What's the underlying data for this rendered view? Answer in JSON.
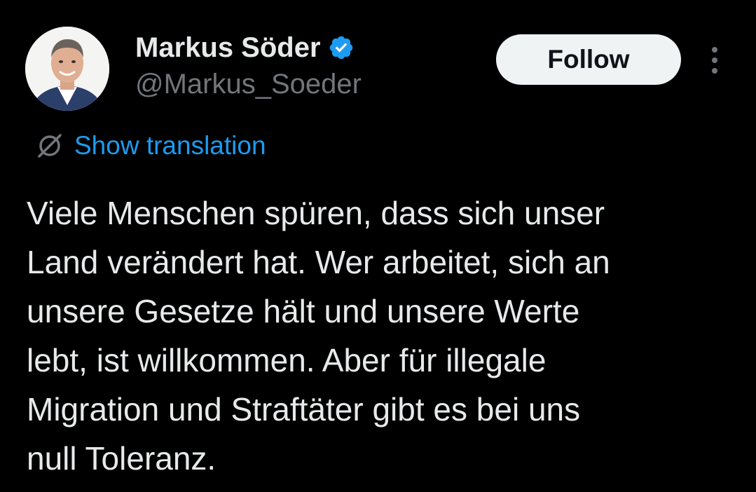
{
  "author": {
    "display_name": "Markus Söder",
    "handle": "@Markus_Soeder",
    "verified": true,
    "verified_icon": "verified-badge-icon",
    "avatar_icon": "profile-photo"
  },
  "actions": {
    "follow_label": "Follow",
    "more_icon": "more-vertical-icon"
  },
  "translation": {
    "label": "Show translation",
    "icon": "translate-icon"
  },
  "tweet": {
    "lines": [
      "Viele Menschen spüren, dass sich unser",
      "Land verändert hat. Wer arbeitet, sich an",
      "unsere Gesetze hält und unsere Werte",
      "lebt, ist willkommen. Aber für illegale",
      "Migration und Straftäter gibt es bei uns",
      "null Toleranz."
    ]
  },
  "colors": {
    "background": "#000000",
    "text_primary": "#e7e9ea",
    "text_secondary": "#71767b",
    "accent": "#1d9bf0",
    "follow_bg": "#eff3f4"
  }
}
